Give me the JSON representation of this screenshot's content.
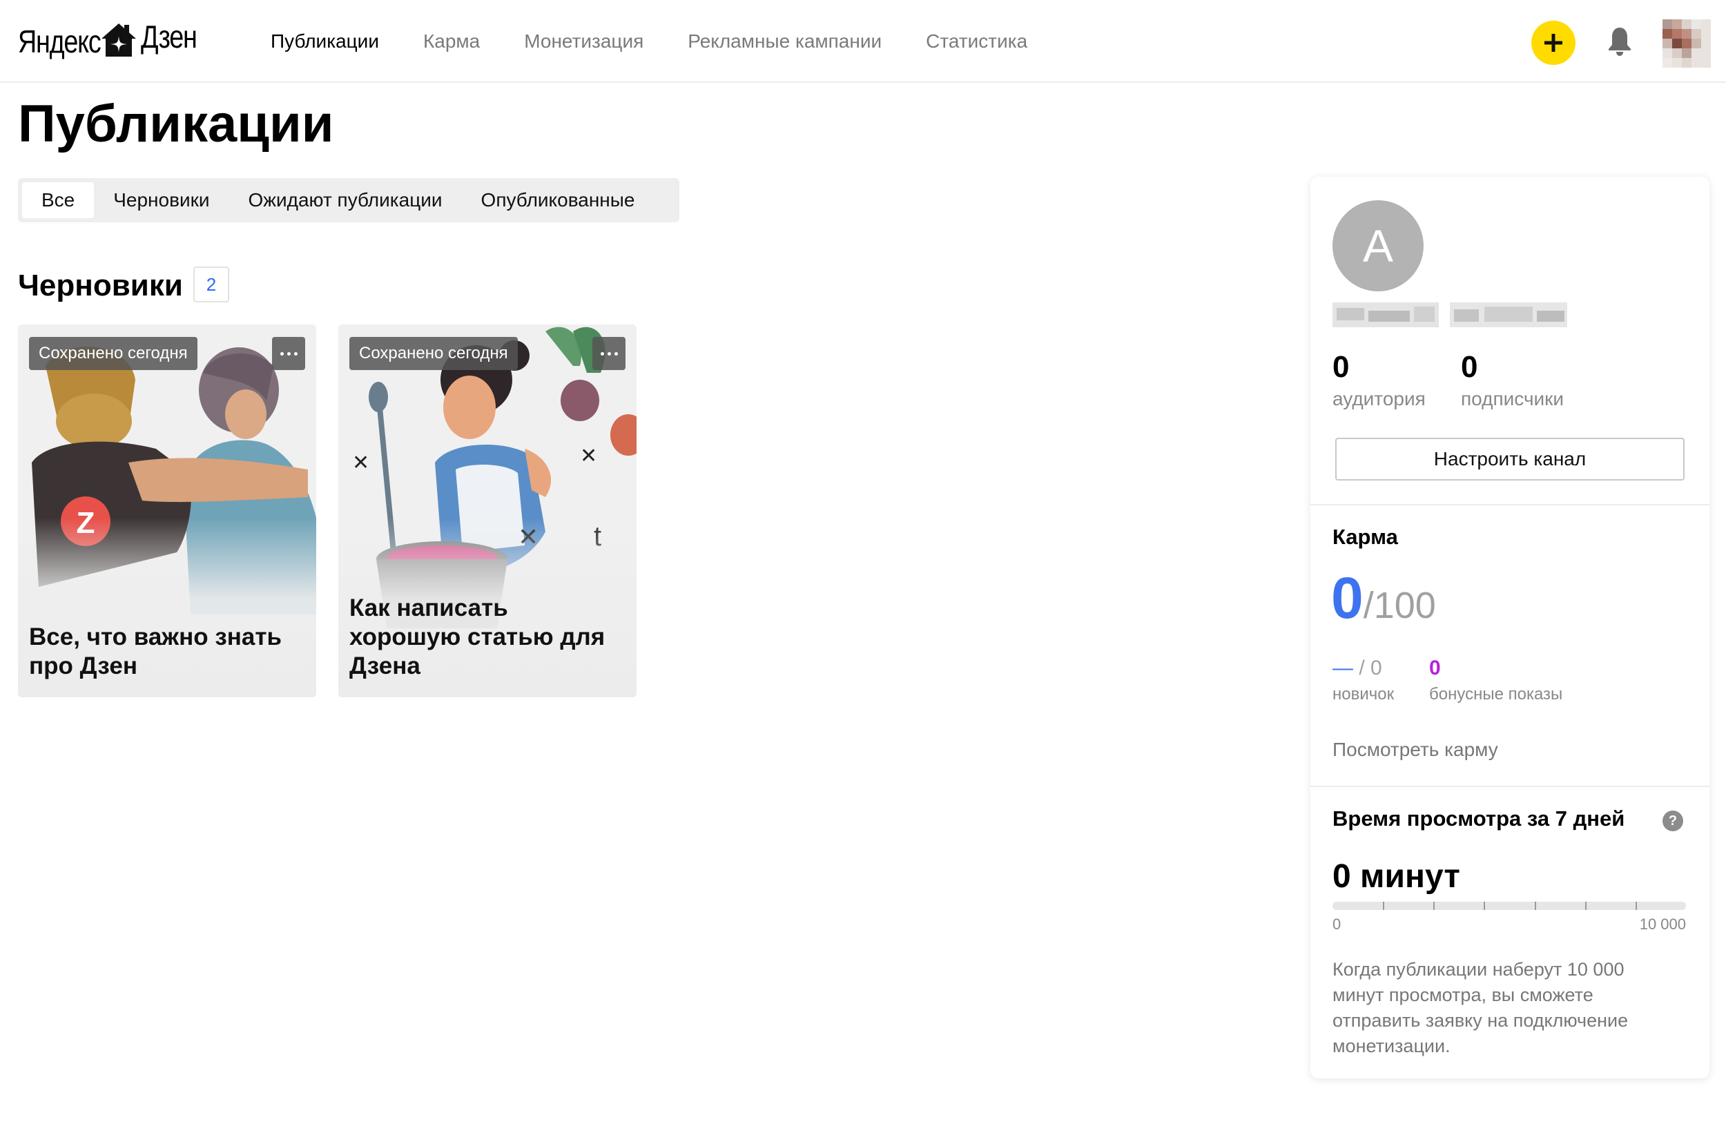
{
  "header": {
    "logo": {
      "yandex": "Яндекс",
      "dzen": "Дзен"
    },
    "nav": [
      {
        "label": "Публикации",
        "active": true
      },
      {
        "label": "Карма",
        "active": false
      },
      {
        "label": "Монетизация",
        "active": false
      },
      {
        "label": "Рекламные кампании",
        "active": false
      },
      {
        "label": "Статистика",
        "active": false
      }
    ],
    "icons": {
      "add": "plus-icon",
      "notifications": "bell-icon",
      "user": "user-avatar"
    },
    "accent": "#ffdb00"
  },
  "page": {
    "title": "Публикации"
  },
  "tabs": [
    {
      "label": "Все",
      "active": true
    },
    {
      "label": "Черновики",
      "active": false
    },
    {
      "label": "Ожидают публикации",
      "active": false
    },
    {
      "label": "Опубликованные",
      "active": false
    }
  ],
  "drafts": {
    "title": "Черновики",
    "count": "2",
    "cards": [
      {
        "badge": "Сохранено сегодня",
        "title": "Все, что важно знать про Дзен"
      },
      {
        "badge": "Сохранено сегодня",
        "title": "Как написать хорошую статью для Дзена"
      }
    ]
  },
  "sidebar": {
    "avatar_letter": "A",
    "stats": [
      {
        "value": "0",
        "label": "аудитория"
      },
      {
        "value": "0",
        "label": "подписчики"
      }
    ],
    "setup_button": "Настроить канал",
    "karma": {
      "title": "Карма",
      "value": "0",
      "max": "/100",
      "level_value": "— / 0",
      "level_label": "новичок",
      "bonus_value": "0",
      "bonus_label": "бонусные показы",
      "link": "Посмотреть карму",
      "value_color": "#3e73f0",
      "bonus_color": "#b522e0"
    },
    "watch": {
      "title": "Время просмотра за 7 дней",
      "value": "0 минут",
      "progress": 0,
      "min_label": "0",
      "max_label": "10 000",
      "note": "Когда публикации наберут 10 000 минут просмотра, вы сможете отправить заявку на подключение монетизации."
    }
  }
}
